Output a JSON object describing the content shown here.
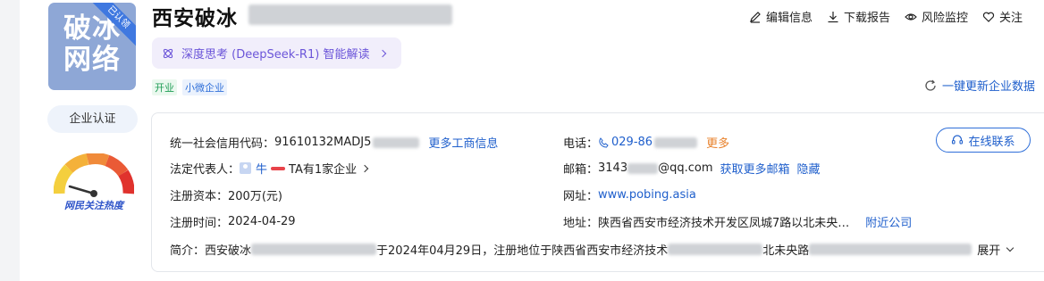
{
  "logo": {
    "text_line1": "破冰",
    "text_line2": "网络",
    "badge": "已认领"
  },
  "certification": {
    "label": "企业认证"
  },
  "heat_gauge": {
    "caption": "网民关注热度"
  },
  "company": {
    "name_prefix": "西安破冰"
  },
  "actions": {
    "edit": "编辑信息",
    "download": "下载报告",
    "monitor": "风险监控",
    "follow": "关注"
  },
  "ai_pill": {
    "label": "深度思考 (DeepSeek-R1) 智能解读"
  },
  "tags": [
    "开业",
    "小微企业"
  ],
  "refresh": {
    "label": "一键更新企业数据"
  },
  "info": {
    "credit_code_label": "统一社会信用代码：",
    "credit_code_value": "91610132MADJ5",
    "more_business": "更多工商信息",
    "legal_rep_label": "法定代表人：",
    "legal_rep_name": "牛",
    "legal_rep_suffix": "TA有1家企业",
    "capital_label": "注册资本：",
    "capital_value": "200万(元)",
    "reg_date_label": "注册时间：",
    "reg_date_value": "2024-04-29",
    "phone_label": "电话：",
    "phone_value": "029-86",
    "phone_more": "更多",
    "email_label": "邮箱：",
    "email_prefix": "3143",
    "email_suffix": "@qq.com",
    "email_more": "获取更多邮箱",
    "email_hide": "隐藏",
    "website_label": "网址：",
    "website_value": "www.pobing.asia",
    "address_label": "地址：",
    "address_value": "陕西省西安市经济技术开发区凤城7路以北未央…",
    "nearby": "附近公司",
    "contact_button": "在线联系",
    "intro_label": "简介：",
    "intro_part1": "西安破冰",
    "intro_part2": "于2024年04月29日，注册地位于陕西省西安市经济技术",
    "intro_part3": "北未央路",
    "expand": "展开"
  },
  "colors": {
    "link": "#1f5fcc",
    "accent_purple": "#6b55d9",
    "orange": "#e8812b",
    "logo_bg": "#8ea7d6"
  }
}
